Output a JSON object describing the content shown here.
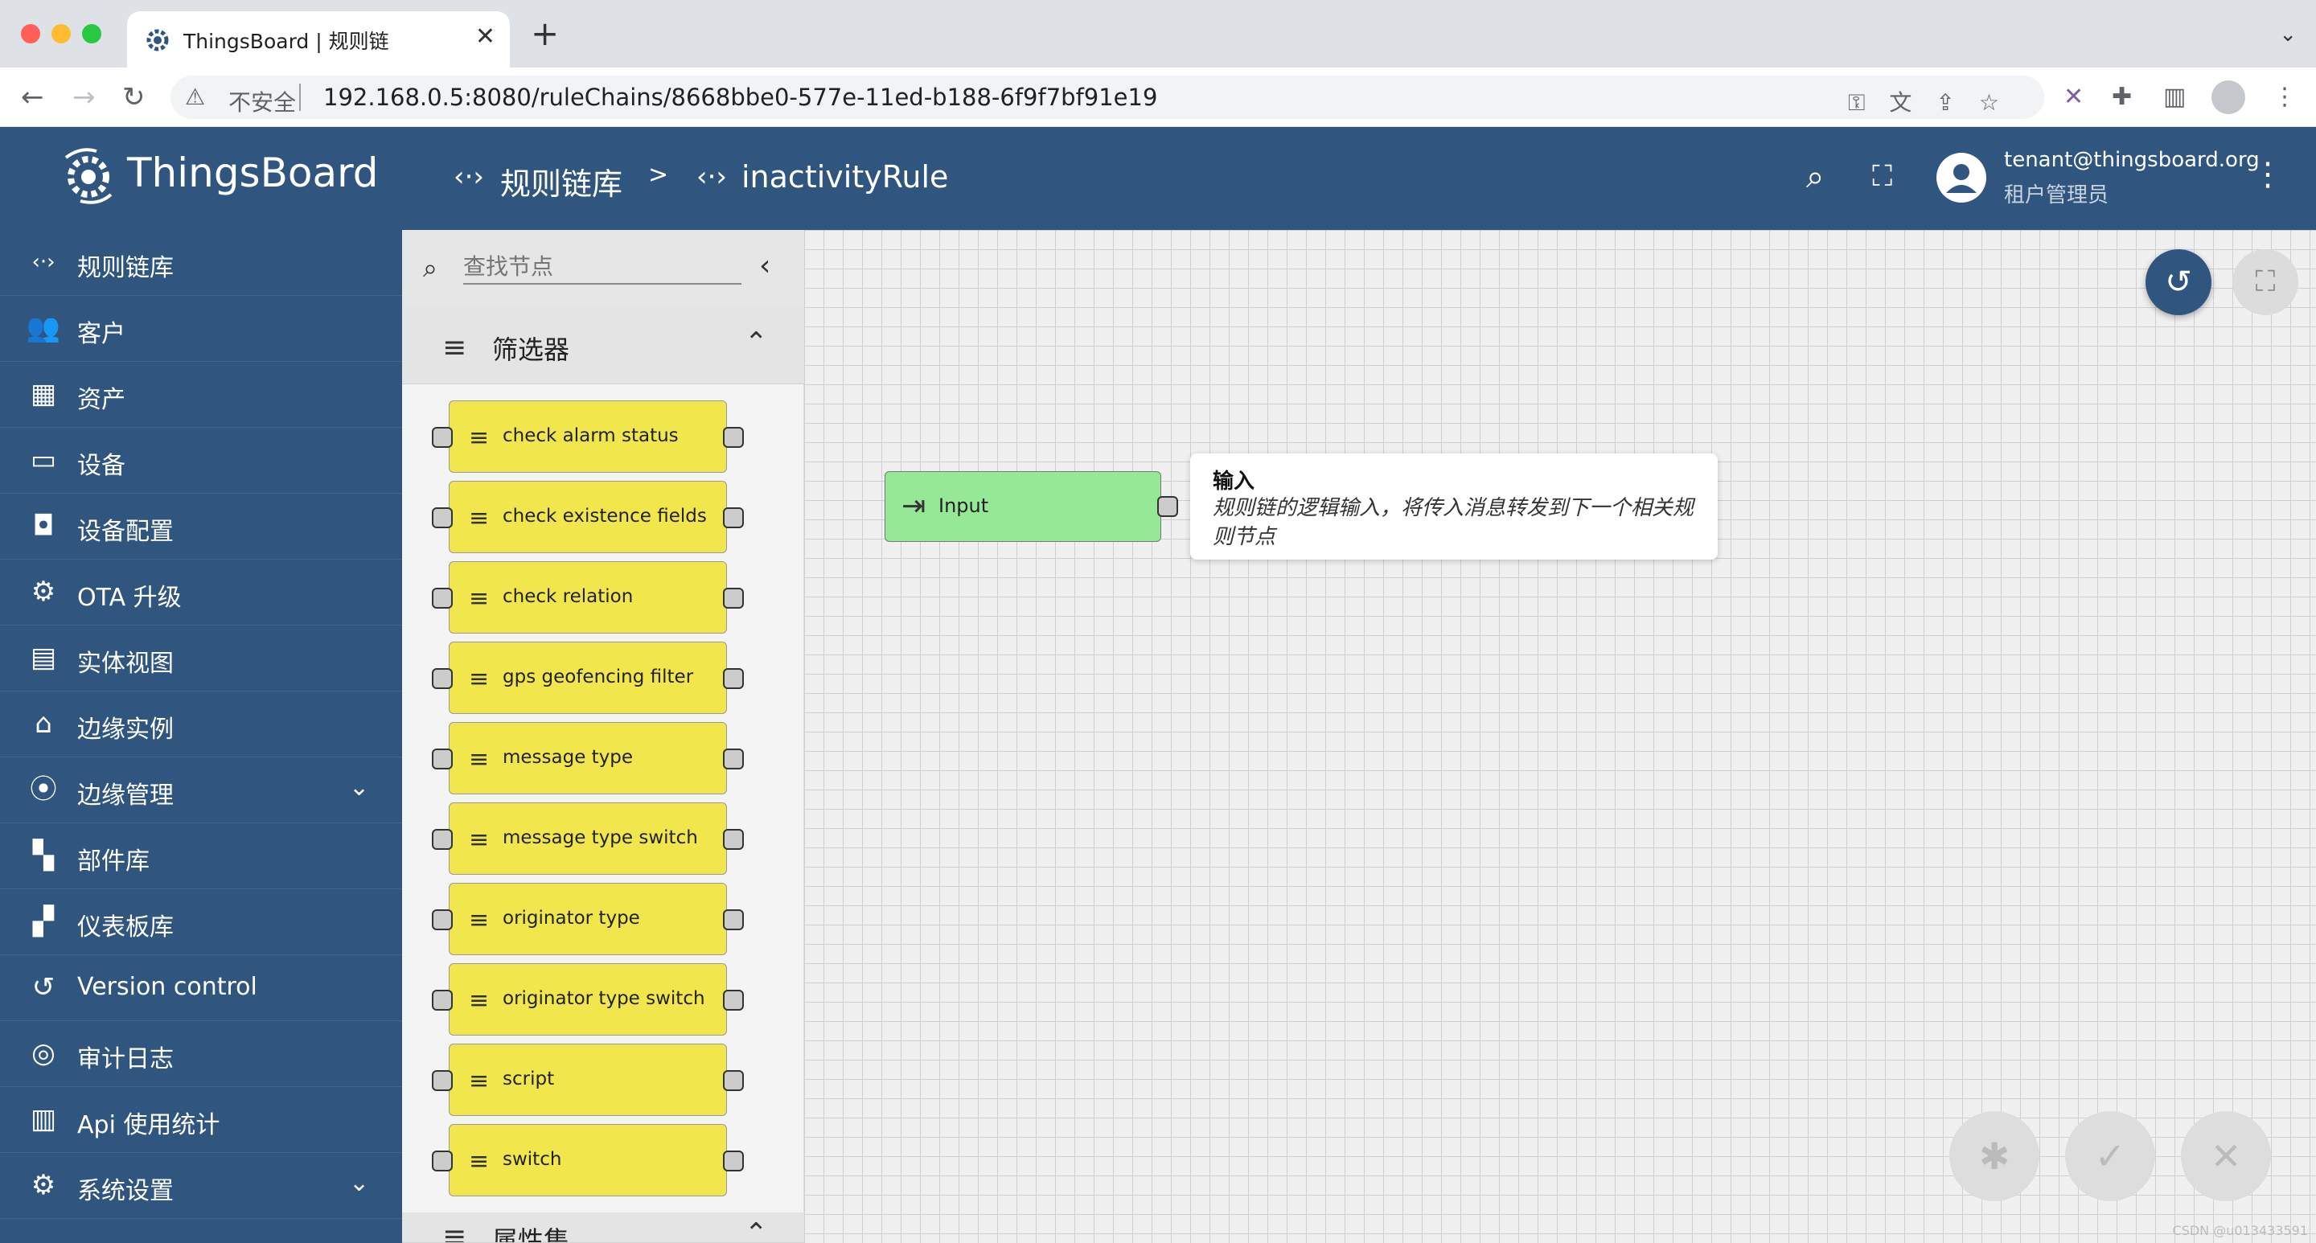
{
  "browser": {
    "tab_title": "ThingsBoard | 规则链",
    "tab_close": "✕",
    "new_tab": "+",
    "tab_menu": "⌄",
    "security_label": "不安全",
    "url": "192.168.0.5:8080/ruleChains/8668bbe0-577e-11ed-b188-6f9f7bf91e19"
  },
  "header": {
    "logo_text": "ThingsBoard",
    "breadcrumb_root": "规则链库",
    "breadcrumb_sep": ">",
    "breadcrumb_current": "inactivityRule",
    "user_email": "tenant@thingsboard.org",
    "user_role": "租户管理员"
  },
  "sidebar": {
    "items": [
      {
        "label": "规则链库",
        "icon": "rule-chain-icon"
      },
      {
        "label": "客户",
        "icon": "customers-icon"
      },
      {
        "label": "资产",
        "icon": "assets-icon"
      },
      {
        "label": "设备",
        "icon": "devices-icon"
      },
      {
        "label": "设备配置",
        "icon": "device-profile-icon"
      },
      {
        "label": "OTA 升级",
        "icon": "ota-icon"
      },
      {
        "label": "实体视图",
        "icon": "entity-view-icon"
      },
      {
        "label": "边缘实例",
        "icon": "edge-icon"
      },
      {
        "label": "边缘管理",
        "icon": "edge-management-icon"
      },
      {
        "label": "部件库",
        "icon": "widgets-icon"
      },
      {
        "label": "仪表板库",
        "icon": "dashboards-icon"
      },
      {
        "label": "Version control",
        "icon": "version-control-icon"
      },
      {
        "label": "审计日志",
        "icon": "audit-log-icon"
      },
      {
        "label": "Api 使用统计",
        "icon": "api-usage-icon"
      },
      {
        "label": "系统设置",
        "icon": "settings-icon"
      }
    ]
  },
  "library": {
    "search_placeholder": "查找节点",
    "sections": [
      {
        "label": "筛选器"
      },
      {
        "label": "属性集"
      }
    ],
    "filter_nodes": [
      "check alarm status",
      "check existence fields",
      "check relation",
      "gps geofencing filter",
      "message type",
      "message type switch",
      "originator type",
      "originator type switch",
      "script",
      "switch"
    ]
  },
  "canvas": {
    "input_node_label": "Input",
    "tooltip_title": "输入",
    "tooltip_desc": "规则链的逻辑输入，将传入消息转发到下一个相关规则节点",
    "watermark": "CSDN @u013433591"
  },
  "colors": {
    "primary": "#305680",
    "filter_node": "#f1e64c",
    "input_node": "#95e896"
  }
}
